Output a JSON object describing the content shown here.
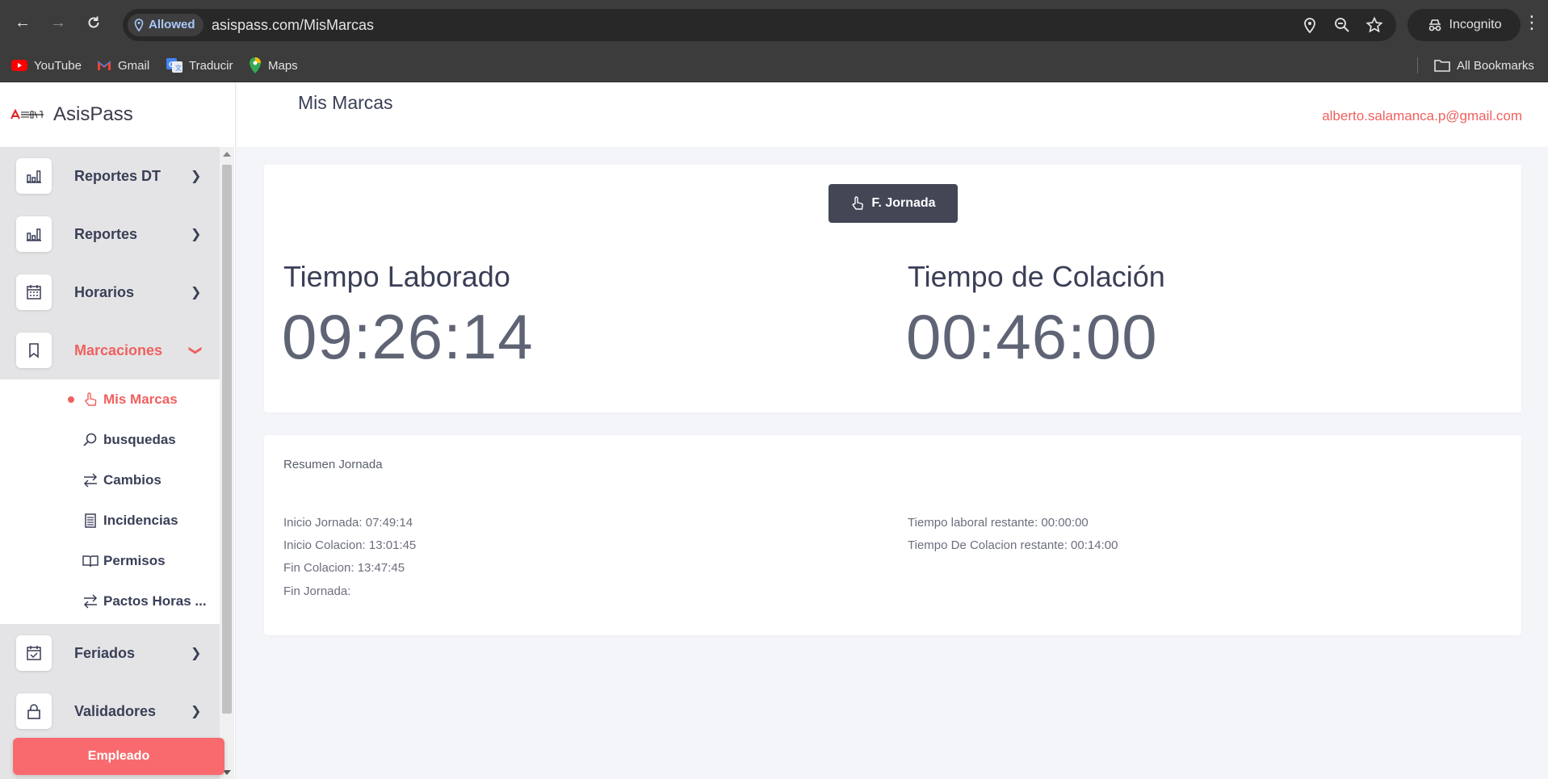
{
  "browser": {
    "permission_chip": "Allowed",
    "url": "asispass.com/MisMarcas",
    "incognito_label": "Incognito",
    "bookmarks": [
      "YouTube",
      "Gmail",
      "Traducir",
      "Maps"
    ],
    "all_bookmarks": "All Bookmarks"
  },
  "brand": {
    "name": "AsisPass"
  },
  "sidebar": {
    "items": [
      {
        "label": "Reportes DT",
        "icon": "bar-chart-icon"
      },
      {
        "label": "Reportes",
        "icon": "bar-chart-icon"
      },
      {
        "label": "Horarios",
        "icon": "calendar-icon"
      },
      {
        "label": "Marcaciones",
        "icon": "bookmark-icon",
        "active": true
      },
      {
        "label": "Feriados",
        "icon": "calendar-check-icon"
      },
      {
        "label": "Validadores",
        "icon": "lock-icon"
      }
    ],
    "submenu": [
      {
        "label": "Mis Marcas",
        "icon": "hand-pointer-icon",
        "active": true
      },
      {
        "label": "busquedas",
        "icon": "search-icon"
      },
      {
        "label": "Cambios",
        "icon": "swap-icon"
      },
      {
        "label": "Incidencias",
        "icon": "list-icon"
      },
      {
        "label": "Permisos",
        "icon": "book-icon"
      },
      {
        "label": "Pactos Horas ...",
        "icon": "swap-icon"
      }
    ],
    "role_button": "Empleado"
  },
  "header": {
    "title": "Mis Marcas",
    "user_email": "alberto.salamanca.p@gmail.com"
  },
  "clock": {
    "button_label": "F. Jornada",
    "worked_label": "Tiempo Laborado",
    "worked_value": "09:26:14",
    "lunch_label": "Tiempo de Colación",
    "lunch_value": "00:46:00"
  },
  "summary": {
    "title": "Resumen Jornada",
    "left": [
      "Inicio Jornada: 07:49:14",
      "Inicio Colacion: 13:01:45",
      "Fin Colacion: 13:47:45",
      "Fin Jornada:"
    ],
    "right": [
      "Tiempo laboral restante: 00:00:00",
      "Tiempo De Colacion restante: 00:14:00"
    ]
  },
  "colors": {
    "accent": "#f0605f",
    "dark_button": "#424655",
    "role_button": "#f96a6e"
  }
}
